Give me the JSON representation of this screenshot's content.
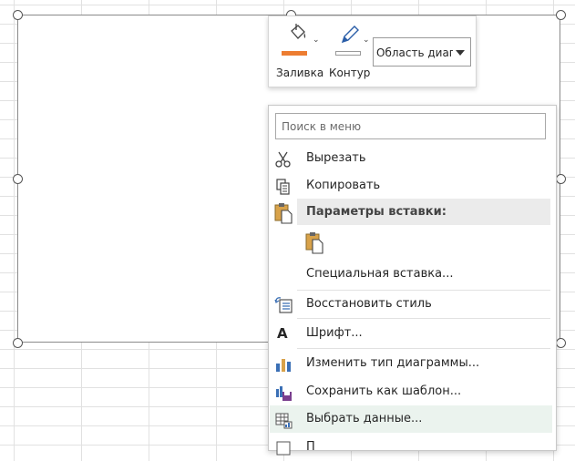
{
  "toolbar": {
    "fill_label": "Заливка",
    "outline_label": "Контур",
    "area_value": "Область диаграммы",
    "fill_color": "#ed7d31"
  },
  "menu": {
    "search_placeholder": "Поиск в меню",
    "cut": "Вырезать",
    "copy": "Копировать",
    "paste_options": "Параметры вставки:",
    "paste_special": "Специальная вставка...",
    "reset_style": "Восстановить стиль",
    "font": "Шрифт...",
    "change_type": "Изменить тип диаграммы...",
    "save_template": "Сохранить как шаблон...",
    "select_data": "Выбрать данные...",
    "next_item": "П"
  }
}
